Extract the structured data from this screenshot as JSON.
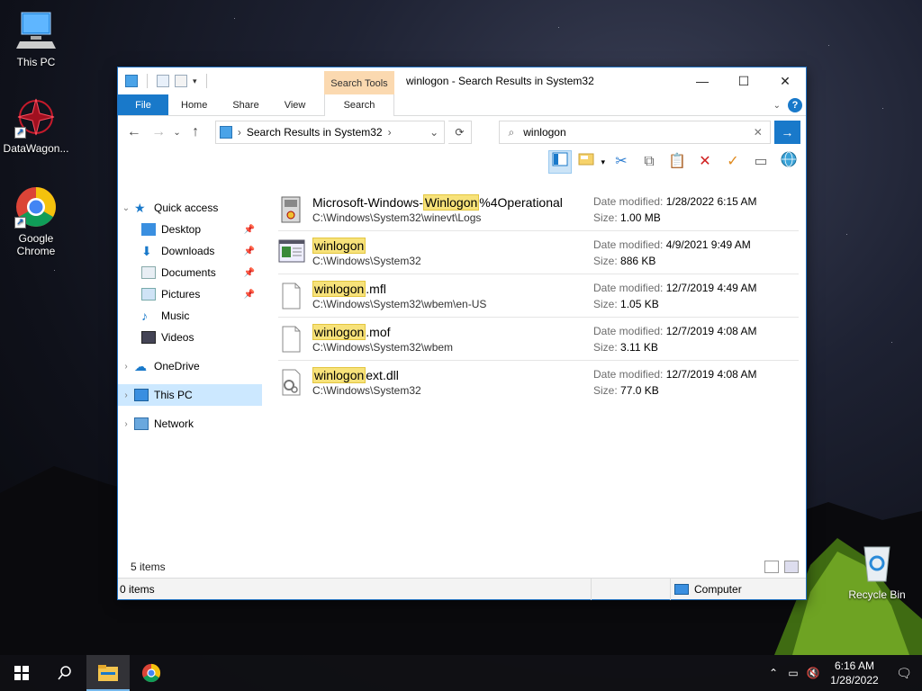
{
  "desktop": {
    "icons": [
      {
        "label": "This PC"
      },
      {
        "label": "DataWagon..."
      },
      {
        "label": "Google Chrome"
      },
      {
        "label": "Recycle Bin"
      }
    ]
  },
  "window": {
    "title": "winlogon - Search Results in System32",
    "context_tab_group": "Search Tools",
    "controls": {
      "minimize": "—",
      "maximize": "☐",
      "close": "✕"
    }
  },
  "ribbon": {
    "tabs": [
      "File",
      "Home",
      "Share",
      "View",
      "Search"
    ],
    "help": "?"
  },
  "address": {
    "path": "Search Results in System32",
    "search_query": "winlogon"
  },
  "navpane": {
    "items": [
      {
        "label": "Quick access"
      },
      {
        "label": "Desktop"
      },
      {
        "label": "Downloads"
      },
      {
        "label": "Documents"
      },
      {
        "label": "Pictures"
      },
      {
        "label": "Music"
      },
      {
        "label": "Videos"
      },
      {
        "label": "OneDrive"
      },
      {
        "label": "This PC"
      },
      {
        "label": "Network"
      }
    ]
  },
  "files": {
    "date_label": "Date modified:",
    "size_label": "Size:",
    "rows": [
      {
        "pre": "Microsoft-Windows-",
        "match": "Winlogon",
        "post": "%4Operational",
        "path": "C:\\Windows\\System32\\winevt\\Logs",
        "date": "1/28/2022 6:15 AM",
        "size": "1.00 MB"
      },
      {
        "pre": "",
        "match": "winlogon",
        "post": "",
        "path": "C:\\Windows\\System32",
        "date": "4/9/2021 9:49 AM",
        "size": "886 KB"
      },
      {
        "pre": "",
        "match": "winlogon",
        "post": ".mfl",
        "path": "C:\\Windows\\System32\\wbem\\en-US",
        "date": "12/7/2019 4:49 AM",
        "size": "1.05 KB"
      },
      {
        "pre": "",
        "match": "winlogon",
        "post": ".mof",
        "path": "C:\\Windows\\System32\\wbem",
        "date": "12/7/2019 4:08 AM",
        "size": "3.11 KB"
      },
      {
        "pre": "",
        "match": "winlogon",
        "post": "ext.dll",
        "path": "C:\\Windows\\System32",
        "date": "12/7/2019 4:08 AM",
        "size": "77.0 KB"
      }
    ]
  },
  "status": {
    "item_count": "5 items",
    "selected": "0 items",
    "location": "Computer"
  },
  "taskbar": {
    "time": "6:16 AM",
    "date": "1/28/2022"
  }
}
